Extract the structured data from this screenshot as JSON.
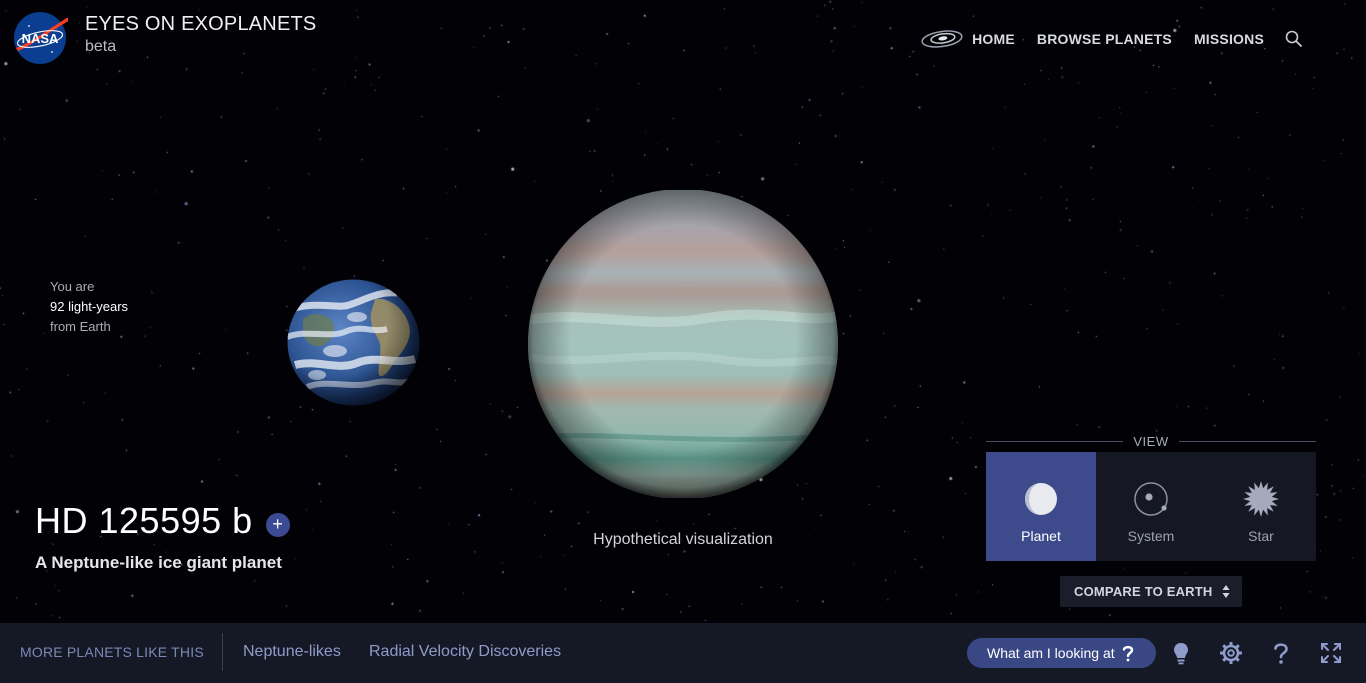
{
  "header": {
    "logo_text": "NASA",
    "title": "EYES ON EXOPLANETS",
    "subtitle": "beta"
  },
  "nav": {
    "items": [
      {
        "label": "HOME"
      },
      {
        "label": "BROWSE PLANETS"
      },
      {
        "label": "MISSIONS"
      }
    ],
    "search_icon": "search-icon",
    "galaxy_icon": "galaxy-icon"
  },
  "distance": {
    "prefix": "You are",
    "value": "92 light-years",
    "suffix": "from Earth"
  },
  "scene": {
    "caption": "Hypothetical visualization"
  },
  "planet": {
    "name": "HD 125595 b",
    "description": "A Neptune-like ice giant planet",
    "add_label": "+"
  },
  "view": {
    "heading": "VIEW",
    "options": [
      {
        "label": "Planet",
        "icon": "planet-icon",
        "active": true
      },
      {
        "label": "System",
        "icon": "system-icon",
        "active": false
      },
      {
        "label": "Star",
        "icon": "star-icon",
        "active": false
      }
    ]
  },
  "compare": {
    "label": "COMPARE TO EARTH"
  },
  "bottom_bar": {
    "more_label": "MORE PLANETS LIKE THIS",
    "links": [
      {
        "label": "Neptune-likes"
      },
      {
        "label": "Radial Velocity Discoveries"
      }
    ],
    "looking_button": "What am I looking at",
    "tools": [
      "lightbulb-icon",
      "gear-icon",
      "help-icon",
      "fullscreen-icon"
    ]
  },
  "colors": {
    "accent": "#3d4a8b",
    "bar_bg": "#151825",
    "link": "#8f9cca",
    "nasa_blue": "#0b3d91",
    "nasa_red": "#fc3d21"
  }
}
